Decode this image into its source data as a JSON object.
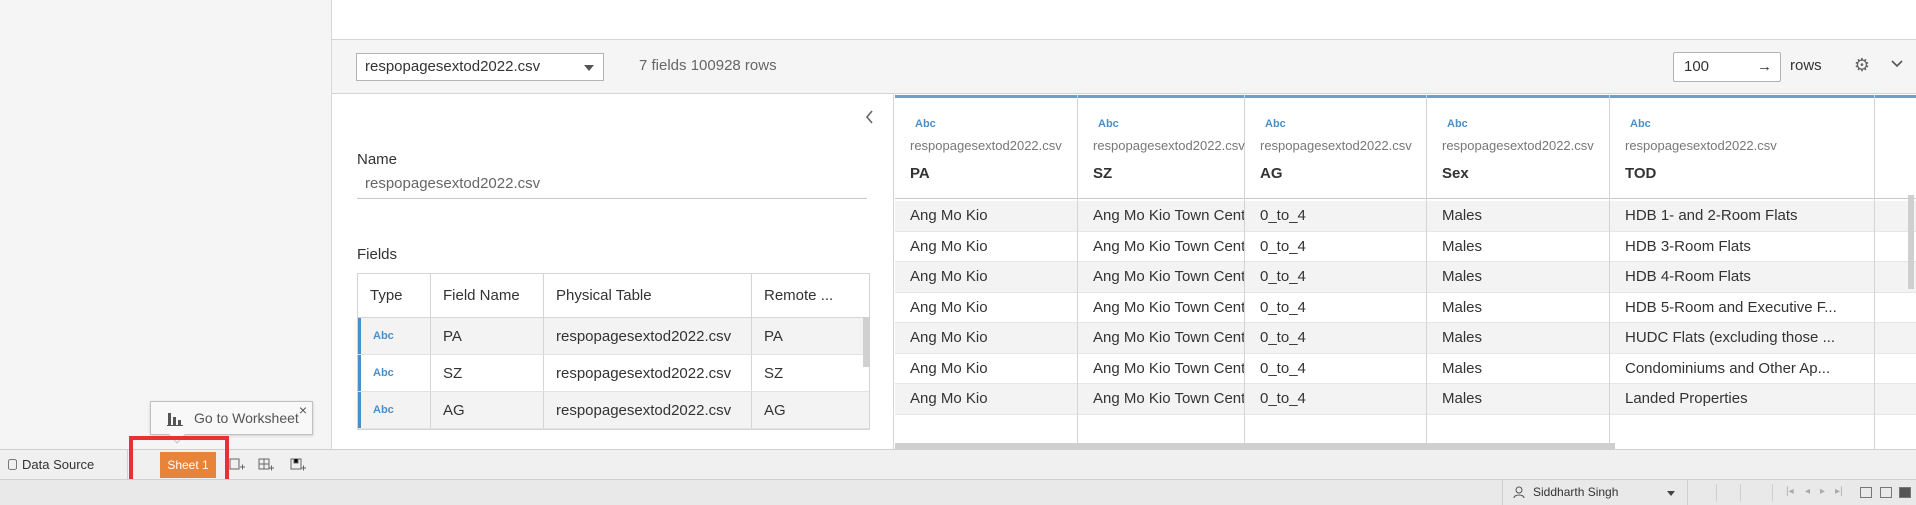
{
  "toolbar": {
    "table_select": "respopagesextod2022.csv",
    "fields_count": "7 fields 100928 rows",
    "rows_value": "100",
    "rows_arrow": "→",
    "rows_label": "rows",
    "settings_icon": "gear-icon",
    "collapse_icon": "chevron-down-icon"
  },
  "metadata": {
    "collapse_icon": "chevron-left-icon",
    "name_label": "Name",
    "name_value": "respopagesextod2022.csv",
    "fields_label": "Fields",
    "columns": [
      "Type",
      "Field Name",
      "Physical Table",
      "Remote ..."
    ],
    "rows": [
      {
        "type": "Abc",
        "field": "PA",
        "table": "respopagesextod2022.csv",
        "remote": "PA"
      },
      {
        "type": "Abc",
        "field": "SZ",
        "table": "respopagesextod2022.csv",
        "remote": "SZ"
      },
      {
        "type": "Abc",
        "field": "AG",
        "table": "respopagesextod2022.csv",
        "remote": "AG"
      }
    ]
  },
  "grid": {
    "columns": [
      {
        "type": "Abc",
        "source": "respopagesextod2022.csv",
        "name": "PA"
      },
      {
        "type": "Abc",
        "source": "respopagesextod2022.csv",
        "name": "SZ"
      },
      {
        "type": "Abc",
        "source": "respopagesextod2022.csv",
        "name": "AG"
      },
      {
        "type": "Abc",
        "source": "respopagesextod2022.csv",
        "name": "Sex"
      },
      {
        "type": "Abc",
        "source": "respopagesextod2022.csv",
        "name": "TOD"
      }
    ],
    "rows": [
      [
        "Ang Mo Kio",
        "Ang Mo Kio Town Centre",
        "0_to_4",
        "Males",
        "HDB 1- and 2-Room Flats"
      ],
      [
        "Ang Mo Kio",
        "Ang Mo Kio Town Centre",
        "0_to_4",
        "Males",
        "HDB 3-Room Flats"
      ],
      [
        "Ang Mo Kio",
        "Ang Mo Kio Town Centre",
        "0_to_4",
        "Males",
        "HDB 4-Room Flats"
      ],
      [
        "Ang Mo Kio",
        "Ang Mo Kio Town Centre",
        "0_to_4",
        "Males",
        "HDB 5-Room and Executive F..."
      ],
      [
        "Ang Mo Kio",
        "Ang Mo Kio Town Centre",
        "0_to_4",
        "Males",
        "HUDC Flats (excluding those ..."
      ],
      [
        "Ang Mo Kio",
        "Ang Mo Kio Town Centre",
        "0_to_4",
        "Males",
        "Condominiums and Other Ap..."
      ],
      [
        "Ang Mo Kio",
        "Ang Mo Kio Town Centre",
        "0_to_4",
        "Males",
        "Landed Properties"
      ]
    ]
  },
  "tabs": {
    "data_source": "Data Source",
    "sheet1": "Sheet 1",
    "new_worksheet_icon": "new-worksheet-icon",
    "new_dashboard_icon": "new-dashboard-icon",
    "new_story_icon": "new-story-icon"
  },
  "tooltip": {
    "label": "Go to Worksheet",
    "close": "×"
  },
  "status": {
    "user_name": "Siddharth Singh"
  },
  "colors": {
    "sheet_tab": "#e8833a",
    "highlight": "#e53232",
    "type_accent": "#4b8fc9"
  }
}
